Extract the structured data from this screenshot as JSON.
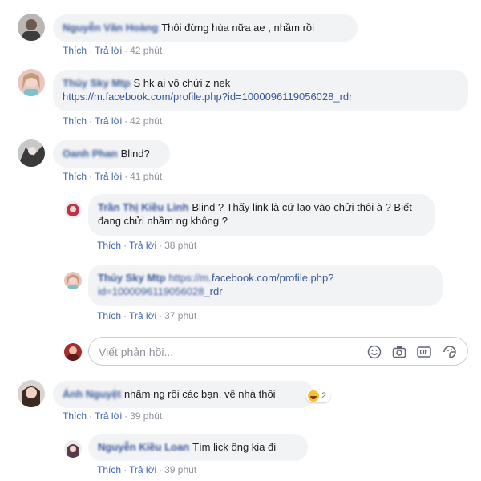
{
  "actions": {
    "like": "Thích",
    "reply": "Trả lời",
    "sep": "·"
  },
  "comments": [
    {
      "author": "Nguyễn Văn Hoàng",
      "text": "Thôi đừng hùa nữa ae , nhầm rồi",
      "time": "42 phút"
    },
    {
      "author": "Thủy Sky Mtp",
      "text": "S hk ai vô chửi z nek",
      "link": "https://m.facebook.com/profile.php?id=1000096119056028_rdr",
      "time": "42 phút"
    },
    {
      "author": "Oanh Phan",
      "text": "Blind?",
      "time": "41 phút",
      "replies": [
        {
          "author": "Trần Thị Kiều Linh",
          "text": "Blind ? Thấy link là cứ lao vào chửi thôi à ? Biết đang chửi nhầm ng không ?",
          "time": "38 phút"
        },
        {
          "author": "Thủy Sky Mtp",
          "link_blur": "https://m.",
          "link": "facebook.com/profile.php?",
          "link2_blur": "id=1000096119056028",
          "link2": "_rdr",
          "time": "37 phút"
        }
      ]
    },
    {
      "author": "Ánh Nguyệt",
      "text": "nhầm ng rồi các bạn. về nhà thôi",
      "time": "39 phút",
      "reaction_count": "2",
      "replies": [
        {
          "author": "Nguyễn Kiều Loan",
          "text": "Tìm lick ông kia đi",
          "time": "39 phút"
        }
      ]
    }
  ],
  "reply_box": {
    "placeholder": "Viết phản hồi..."
  },
  "icons": [
    "emoji-icon",
    "camera-icon",
    "gif-icon",
    "sticker-icon"
  ]
}
